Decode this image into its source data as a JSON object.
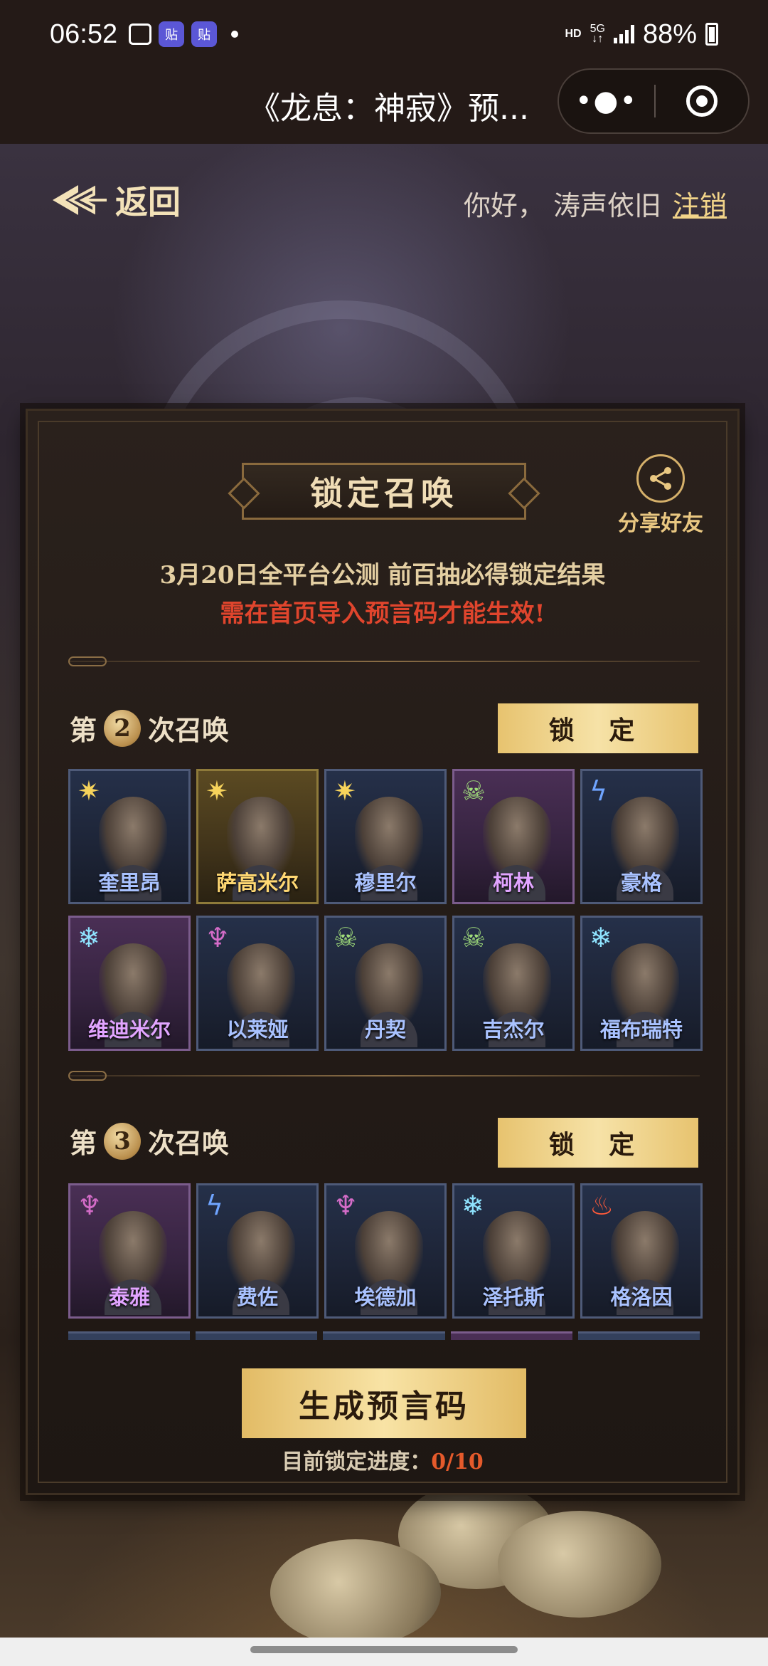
{
  "status_bar": {
    "time": "06:52",
    "network_hd": "HD",
    "network_5g": "5G",
    "battery": "88%"
  },
  "title_bar": {
    "title": "《龙息：神寂》预...",
    "more_icon": "more-dots-icon",
    "close_icon": "target-close-icon"
  },
  "header": {
    "back_label": "返回",
    "greeting": "你好，  涛声依旧",
    "logout_label": "注销"
  },
  "panel": {
    "title": "锁定召唤",
    "share_label": "分享好友",
    "notice_1": "3月20日全平台公测 前百抽必得锁定结果",
    "notice_2": "需在首页导入预言码才能生效!",
    "lock_label": "锁 定",
    "generate_label": "生成预言码",
    "progress_label": "目前锁定进度：",
    "progress_value": "0/10"
  },
  "rounds": [
    {
      "prefix": "第",
      "number": "2",
      "suffix": "次召唤",
      "rows": [
        [
          {
            "name": "奎里昂",
            "element": "sun",
            "frame": "blue"
          },
          {
            "name": "萨高米尔",
            "element": "sun",
            "frame": "gold"
          },
          {
            "name": "穆里尔",
            "element": "sun",
            "frame": "blue"
          },
          {
            "name": "柯林",
            "element": "skull",
            "frame": "purple"
          },
          {
            "name": "豪格",
            "element": "bolt",
            "frame": "blue"
          }
        ],
        [
          {
            "name": "维迪米尔",
            "element": "frost",
            "frame": "purple"
          },
          {
            "name": "以莱娅",
            "element": "demon",
            "frame": "blue"
          },
          {
            "name": "丹契",
            "element": "skull",
            "frame": "blue"
          },
          {
            "name": "吉杰尔",
            "element": "skull",
            "frame": "blue"
          },
          {
            "name": "福布瑞特",
            "element": "frost",
            "frame": "blue"
          }
        ]
      ]
    },
    {
      "prefix": "第",
      "number": "3",
      "suffix": "次召唤",
      "rows": [
        [
          {
            "name": "泰雅",
            "element": "demon",
            "frame": "purple"
          },
          {
            "name": "费佐",
            "element": "bolt",
            "frame": "blue"
          },
          {
            "name": "埃德加",
            "element": "demon",
            "frame": "blue"
          },
          {
            "name": "泽托斯",
            "element": "frost",
            "frame": "blue"
          },
          {
            "name": "格洛因",
            "element": "fire",
            "frame": "blue"
          }
        ]
      ]
    }
  ],
  "colors": {
    "accent_gold": "#e7c36f",
    "warning_red": "#e0452d",
    "progress_orange": "#e55a2b"
  }
}
